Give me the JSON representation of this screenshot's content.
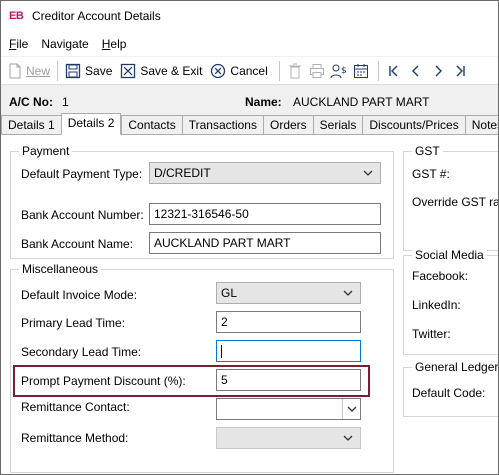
{
  "window": {
    "app_badge": "EB",
    "title": "Creditor Account Details"
  },
  "menu": [
    {
      "label": "File",
      "hotkey_index": 0
    },
    {
      "label": "Navigate",
      "hotkey_index": -1
    },
    {
      "label": "Help",
      "hotkey_index": 0
    }
  ],
  "toolbar": {
    "new_label": "New",
    "save_label": "Save",
    "save_exit_label": "Save & Exit",
    "cancel_label": "Cancel"
  },
  "header": {
    "acno_label": "A/C No:",
    "acno_value": "1",
    "name_label": "Name:",
    "name_value": "AUCKLAND PART MART"
  },
  "tabs": [
    "Details 1",
    "Details 2",
    "Contacts",
    "Transactions",
    "Orders",
    "Serials",
    "Discounts/Prices",
    "Notes"
  ],
  "payment": {
    "title": "Payment",
    "default_type_label": "Default Payment Type:",
    "default_type_value": "D/CREDIT",
    "bank_number_label": "Bank Account Number:",
    "bank_number_value": "12321-316546-50",
    "bank_name_label": "Bank Account Name:",
    "bank_name_value": "AUCKLAND PART MART"
  },
  "misc": {
    "title": "Miscellaneous",
    "invoice_mode_label": "Default Invoice Mode:",
    "invoice_mode_value": "GL",
    "primary_lead_label": "Primary Lead Time:",
    "primary_lead_value": "2",
    "secondary_lead_label": "Secondary Lead Time:",
    "secondary_lead_value": "",
    "prompt_discount_label": "Prompt Payment Discount (%):",
    "prompt_discount_value": "5",
    "remit_contact_label": "Remittance Contact:",
    "remit_method_label": "Remittance Method:"
  },
  "gst": {
    "title": "GST",
    "gst_no_label": "GST #:",
    "override_label": "Override GST rate"
  },
  "social": {
    "title": "Social Media",
    "facebook_label": "Facebook:",
    "linkedin_label": "LinkedIn:",
    "twitter_label": "Twitter:"
  },
  "ledger": {
    "title": "General Ledger",
    "default_code_label": "Default Code:"
  },
  "colors": {
    "highlight_border": "#7a1f33",
    "app_badge": "#c0136b",
    "focus_border": "#0078d7"
  }
}
